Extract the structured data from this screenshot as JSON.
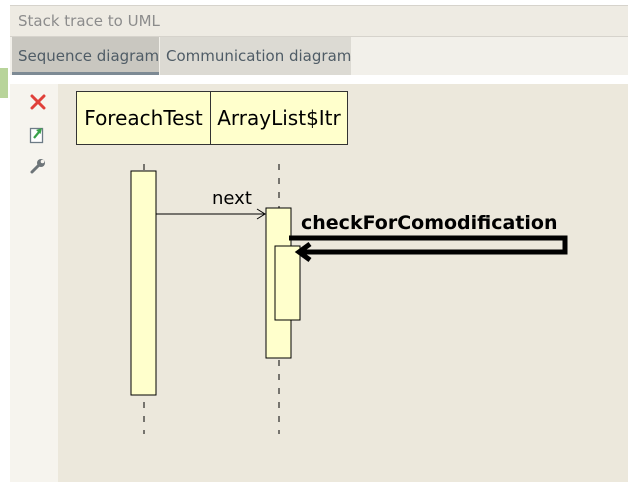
{
  "window": {
    "title": "Stack trace to UML"
  },
  "tabs": [
    {
      "label": "Sequence diagram",
      "selected": true
    },
    {
      "label": "Communication diagram",
      "selected": false
    }
  ],
  "toolbar": {
    "icons": [
      "close-icon",
      "export-icon",
      "wrench-icon"
    ],
    "close_color": "#e0403a",
    "export_color": "#3aa24a"
  },
  "diagram": {
    "lifelines": [
      "ForeachTest",
      "ArrayList$Itr"
    ],
    "messages": [
      {
        "label": "next",
        "from": "ForeachTest",
        "to": "ArrayList$Itr"
      },
      {
        "label": "checkForComodification",
        "from": "ArrayList$Itr",
        "to": "ArrayList$Itr",
        "self": true
      }
    ],
    "colors": {
      "canvas": "#ece8dc",
      "box_fill": "#ffffcc",
      "line": "#000000"
    }
  }
}
